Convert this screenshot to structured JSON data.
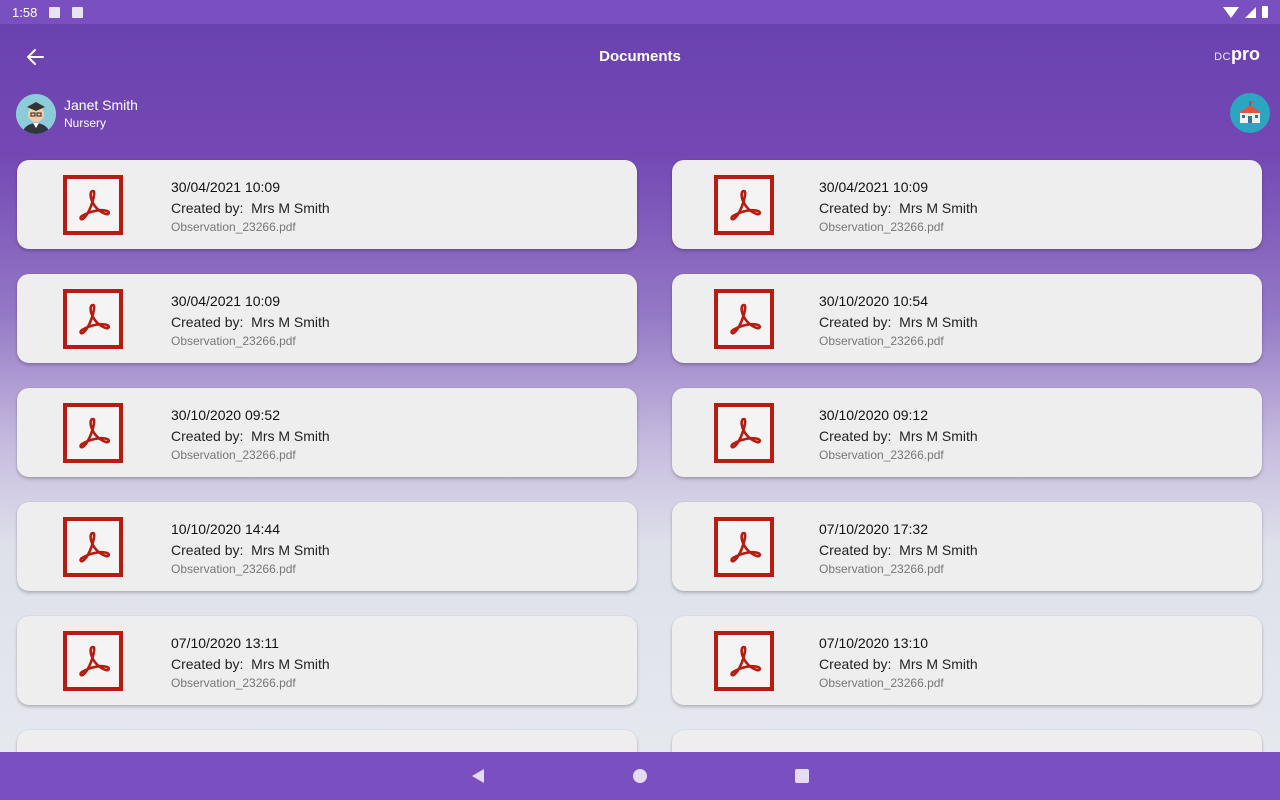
{
  "status_bar": {
    "time": "1:58"
  },
  "header": {
    "title": "Documents",
    "brand_dc": "DC",
    "brand_pro": "pro"
  },
  "profile": {
    "name": "Janet Smith",
    "room": "Nursery"
  },
  "labels": {
    "created_by": "Created by:"
  },
  "documents": [
    {
      "date": "30/04/2021 10:09",
      "creator": "Mrs M Smith",
      "file": "Observation_23266.pdf"
    },
    {
      "date": "30/04/2021 10:09",
      "creator": "Mrs M Smith",
      "file": "Observation_23266.pdf"
    },
    {
      "date": "30/04/2021 10:09",
      "creator": "Mrs M Smith",
      "file": "Observation_23266.pdf"
    },
    {
      "date": "30/10/2020 10:54",
      "creator": "Mrs M Smith",
      "file": "Observation_23266.pdf"
    },
    {
      "date": "30/10/2020 09:52",
      "creator": "Mrs M Smith",
      "file": "Observation_23266.pdf"
    },
    {
      "date": "30/10/2020 09:12",
      "creator": "Mrs M Smith",
      "file": "Observation_23266.pdf"
    },
    {
      "date": "10/10/2020 14:44",
      "creator": "Mrs M Smith",
      "file": "Observation_23266.pdf"
    },
    {
      "date": "07/10/2020 17:32",
      "creator": "Mrs M Smith",
      "file": "Observation_23266.pdf"
    },
    {
      "date": "07/10/2020 13:11",
      "creator": "Mrs M Smith",
      "file": "Observation_23266.pdf"
    },
    {
      "date": "07/10/2020 13:10",
      "creator": "Mrs M Smith",
      "file": "Observation_23266.pdf"
    }
  ],
  "colors": {
    "primary": "#7a4fc0",
    "pdf_red": "#b71c10",
    "card": "#eeeeee"
  },
  "icons": {
    "back": "arrow-back-icon",
    "school": "school-icon",
    "pdf": "pdf-icon",
    "nav_back": "triangle-back-icon",
    "nav_home": "circle-home-icon",
    "nav_recents": "square-recents-icon"
  }
}
